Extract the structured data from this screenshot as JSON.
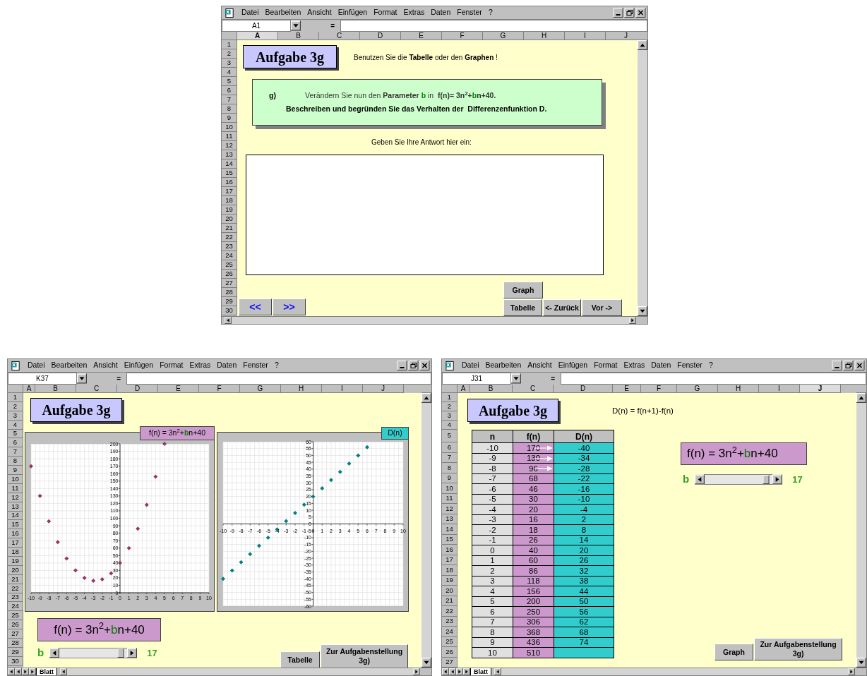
{
  "top_window": {
    "menu": [
      "Datei",
      "Bearbeiten",
      "Ansicht",
      "Einfügen",
      "Format",
      "Extras",
      "Daten",
      "Fenster",
      "?"
    ],
    "name_box": "A1",
    "formula_sign": "=",
    "columns": [
      {
        "label": "A",
        "selected": true
      },
      {
        "label": "B",
        "selected": false
      },
      {
        "label": "C",
        "selected": false
      },
      {
        "label": "D",
        "selected": false
      },
      {
        "label": "E",
        "selected": false
      },
      {
        "label": "F",
        "selected": false
      },
      {
        "label": "G",
        "selected": false
      },
      {
        "label": "H",
        "selected": false
      },
      {
        "label": "I",
        "selected": false
      },
      {
        "label": "J",
        "selected": false
      }
    ],
    "rows": [
      "1",
      "2",
      "3",
      "4",
      "5",
      "6",
      "7",
      "8",
      "9",
      "10",
      "11",
      "12",
      "13",
      "14",
      "15",
      "16",
      "17",
      "18",
      "19",
      "20",
      "21",
      "22",
      "23",
      "24",
      "25",
      "26",
      "27",
      "28",
      "29",
      "30"
    ],
    "title": "Aufgabe 3g",
    "hint": "Benutzen Sie die **Tabelle** oder den **Graphen** !",
    "task": {
      "letter": "g)",
      "line_1": [
        {
          "text": "Verändern Sie nun den ",
          "bold": false
        },
        {
          "text": "Parameter ",
          "bold": true
        },
        {
          "text": "b",
          "bold": true,
          "color": "#008000"
        },
        {
          "text": " in  ",
          "bold": false
        },
        {
          "text": "f(n)= 3n$^{2}$+",
          "bold": true
        },
        {
          "text": "b",
          "bold": true,
          "color": "#008000"
        },
        {
          "text": "n+40.",
          "bold": true
        }
      ],
      "line_2": "Beschreiben und begründen Sie das Verhalten der  Differenzenfunktion D."
    },
    "answer_prompt": "Geben Sie Ihre Antwort hier ein:",
    "nav_buttons": [
      "<<",
      ">>"
    ],
    "buttons": [
      "Graph",
      "Tabelle",
      "<- Zurück",
      "Vor ->"
    ]
  },
  "graph_window": {
    "menu": [
      "Datei",
      "Bearbeiten",
      "Ansicht",
      "Einfügen",
      "Format",
      "Extras",
      "Daten",
      "Fenster",
      "?"
    ],
    "name_box": "K37",
    "formula_sign": "=",
    "columns": [
      {
        "label": "A",
        "selected": false
      },
      {
        "label": "B",
        "selected": false
      },
      {
        "label": "C",
        "selected": false
      },
      {
        "label": "D",
        "selected": false
      },
      {
        "label": "E",
        "selected": false
      },
      {
        "label": "F",
        "selected": false
      },
      {
        "label": "G",
        "selected": false
      },
      {
        "label": "H",
        "selected": false
      },
      {
        "label": "I",
        "selected": false
      },
      {
        "label": "J",
        "selected": false
      }
    ],
    "rows": [
      "1",
      "2",
      "3",
      "4",
      "5",
      "6",
      "7",
      "8",
      "9",
      "10",
      "11",
      "12",
      "13",
      "14",
      "15",
      "16",
      "17",
      "18",
      "19",
      "20",
      "21",
      "22",
      "23",
      "24",
      "25",
      "26",
      "27",
      "28",
      "29",
      "30"
    ],
    "title": "Aufgabe 3g",
    "charts": [
      {
        "label": [
          {
            "text": "f(n) = 3n$^{2}$+",
            "bold": false
          },
          {
            "text": "b",
            "bold": true,
            "color": "#008000"
          },
          {
            "text": "n+40",
            "bold": false
          }
        ],
        "chart_data": {
          "type": "scatter",
          "x": [
            -10,
            -9,
            -8,
            -7,
            -6,
            -5,
            -4,
            -3,
            -2,
            -1,
            0,
            1,
            2,
            3,
            4,
            5
          ],
          "series": [
            {
              "color": "#993366",
              "values": [
                170,
                130,
                96,
                68,
                46,
                30,
                20,
                16,
                18,
                26,
                40,
                60,
                86,
                118,
                156,
                200
              ]
            }
          ],
          "grid": true,
          "xlim": [
            -10,
            10
          ],
          "ylim": [
            0,
            200
          ],
          "xticks": [
            -10,
            -9,
            -8,
            -7,
            -6,
            -5,
            -4,
            -3,
            -2,
            -1,
            0,
            1,
            2,
            3,
            4,
            5,
            6,
            7,
            8,
            9,
            10
          ],
          "yticks": [
            0,
            10,
            20,
            30,
            40,
            50,
            60,
            70,
            80,
            90,
            100,
            110,
            120,
            130,
            140,
            150,
            160,
            170,
            180,
            190,
            200
          ]
        }
      },
      {
        "label": [
          {
            "text": "D(n)",
            "bold": false
          }
        ],
        "chart_data": {
          "type": "scatter",
          "x": [
            -10,
            -9,
            -8,
            -7,
            -6,
            -5,
            -4,
            -3,
            -2,
            -1,
            0,
            1,
            2,
            3,
            4,
            5,
            6
          ],
          "series": [
            {
              "color": "#008080",
              "values": [
                -40,
                -34,
                -28,
                -22,
                -16,
                -10,
                -4,
                2,
                8,
                14,
                20,
                26,
                32,
                38,
                44,
                50,
                56
              ]
            }
          ],
          "grid": true,
          "xlim": [
            -10,
            10
          ],
          "ylim": [
            -60,
            60
          ],
          "xticks": [
            -10,
            -9,
            -8,
            -7,
            -6,
            -5,
            -4,
            -3,
            -2,
            -1,
            0,
            1,
            2,
            3,
            4,
            5,
            6,
            7,
            8,
            9,
            10
          ],
          "yticks": [
            -60,
            -55,
            -50,
            -45,
            -40,
            -35,
            -30,
            -25,
            -20,
            -15,
            -10,
            -5,
            0,
            5,
            10,
            15,
            20,
            25,
            30,
            35,
            40,
            45,
            50,
            55,
            60
          ]
        }
      }
    ],
    "formula": [
      {
        "text": "f(n) = 3n$^{2}$+",
        "bold": false
      },
      {
        "text": "b",
        "bold": false,
        "color": "#008000"
      },
      {
        "text": "n+40",
        "bold": false
      }
    ],
    "slider": {
      "label": "b",
      "level": 0.9,
      "reading": "17"
    },
    "buttons": [
      "Tabelle",
      "Zur Aufgabenstellung 3g)"
    ],
    "sheet_tab": "Blatt"
  },
  "table_window": {
    "menu": [
      "Datei",
      "Bearbeiten",
      "Ansicht",
      "Einfügen",
      "Format",
      "Extras",
      "Daten",
      "Fenster",
      "?"
    ],
    "name_box": "J31",
    "formula_sign": "=",
    "columns": [
      {
        "label": "A",
        "selected": false
      },
      {
        "label": "B",
        "selected": false
      },
      {
        "label": "C",
        "selected": false
      },
      {
        "label": "D",
        "selected": false
      },
      {
        "label": "E",
        "selected": false
      },
      {
        "label": "F",
        "selected": false
      },
      {
        "label": "G",
        "selected": false
      },
      {
        "label": "H",
        "selected": false
      },
      {
        "label": "I",
        "selected": false
      },
      {
        "label": "J",
        "selected": true
      }
    ],
    "rows": [
      "1",
      "2",
      "3",
      "4",
      "5",
      "6",
      "7",
      "8",
      "9",
      "10",
      "11",
      "12",
      "13",
      "14",
      "15",
      "16",
      "17",
      "18",
      "19",
      "20",
      "21",
      "22",
      "23",
      "24",
      "25",
      "26",
      "27"
    ],
    "title": "Aufgabe 3g",
    "caption": "D(n) = f(n+1)-f(n)",
    "table": {
      "columns": [
        "n",
        "f(n)",
        "D(n)"
      ],
      "rows": [
        {
          "cells": [
            "-10",
            "170",
            "-40"
          ],
          "arrow": true
        },
        {
          "cells": [
            "-9",
            "130",
            "-34"
          ],
          "arrow": true
        },
        {
          "cells": [
            "-8",
            "96",
            "-28"
          ],
          "arrow": true
        },
        {
          "cells": [
            "-7",
            "68",
            "-22"
          ],
          "arrow": false
        },
        {
          "cells": [
            "-6",
            "46",
            "-16"
          ],
          "arrow": false
        },
        {
          "cells": [
            "-5",
            "30",
            "-10"
          ],
          "arrow": false
        },
        {
          "cells": [
            "-4",
            "20",
            "-4"
          ],
          "arrow": false
        },
        {
          "cells": [
            "-3",
            "16",
            "2"
          ],
          "arrow": false
        },
        {
          "cells": [
            "-2",
            "18",
            "8"
          ],
          "arrow": false
        },
        {
          "cells": [
            "-1",
            "26",
            "14"
          ],
          "arrow": false
        },
        {
          "cells": [
            "0",
            "40",
            "20"
          ],
          "arrow": false
        },
        {
          "cells": [
            "1",
            "60",
            "26"
          ],
          "arrow": false
        },
        {
          "cells": [
            "2",
            "86",
            "32"
          ],
          "arrow": false
        },
        {
          "cells": [
            "3",
            "118",
            "38"
          ],
          "arrow": false
        },
        {
          "cells": [
            "4",
            "156",
            "44"
          ],
          "arrow": false
        },
        {
          "cells": [
            "5",
            "200",
            "50"
          ],
          "arrow": false
        },
        {
          "cells": [
            "6",
            "250",
            "56"
          ],
          "arrow": false
        },
        {
          "cells": [
            "7",
            "306",
            "62"
          ],
          "arrow": false
        },
        {
          "cells": [
            "8",
            "368",
            "68"
          ],
          "arrow": false
        },
        {
          "cells": [
            "9",
            "436",
            "74"
          ],
          "arrow": false
        },
        {
          "cells": [
            "10",
            "510"
          ],
          "arrow": false
        }
      ]
    },
    "formula": [
      {
        "text": "f(n) = 3n$^{2}$+",
        "bold": false
      },
      {
        "text": "b",
        "bold": false,
        "color": "#008000"
      },
      {
        "text": "n+40",
        "bold": false
      }
    ],
    "slider": {
      "label": "b",
      "level": 0.9,
      "reading": "17"
    },
    "buttons": [
      "Graph",
      "Zur Aufgabenstellung 3g)"
    ],
    "sheet_tab": "Blatt"
  }
}
